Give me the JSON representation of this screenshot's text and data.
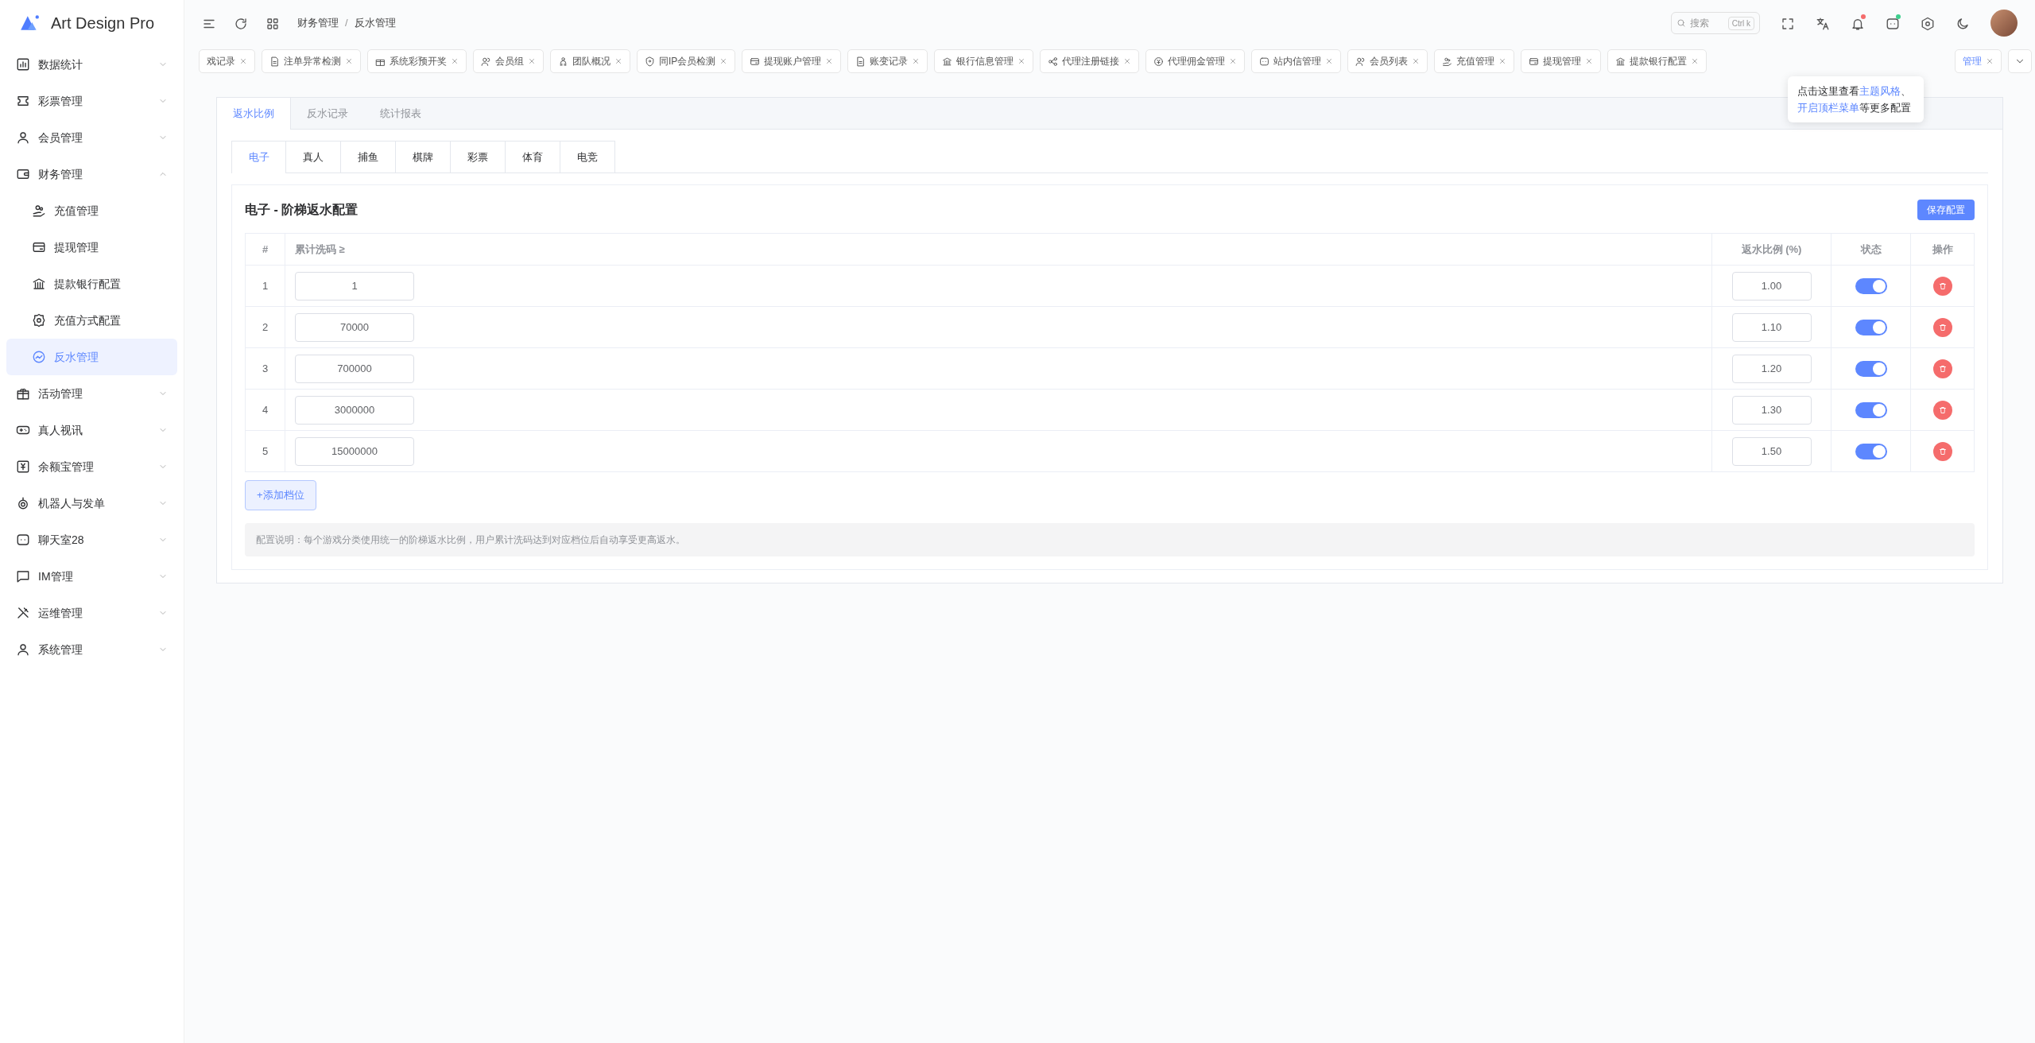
{
  "app": {
    "name": "Art Design Pro"
  },
  "sidebar": {
    "items": [
      {
        "label": "数据统计",
        "expanded": false
      },
      {
        "label": "彩票管理",
        "expanded": false
      },
      {
        "label": "会员管理",
        "expanded": false
      },
      {
        "label": "财务管理",
        "expanded": true,
        "children": [
          {
            "label": "充值管理",
            "selected": false
          },
          {
            "label": "提现管理",
            "selected": false
          },
          {
            "label": "提款银行配置",
            "selected": false
          },
          {
            "label": "充值方式配置",
            "selected": false
          },
          {
            "label": "反水管理",
            "selected": true
          }
        ]
      },
      {
        "label": "活动管理",
        "expanded": false
      },
      {
        "label": "真人视讯",
        "expanded": false
      },
      {
        "label": "余额宝管理",
        "expanded": false
      },
      {
        "label": "机器人与发单",
        "expanded": false
      },
      {
        "label": "聊天室28",
        "expanded": false
      },
      {
        "label": "IM管理",
        "expanded": false
      },
      {
        "label": "运维管理",
        "expanded": false
      },
      {
        "label": "系统管理",
        "expanded": false
      }
    ]
  },
  "breadcrumb": [
    "财务管理",
    "反水管理"
  ],
  "breadcrumb_separator": "/",
  "search": {
    "placeholder": "搜索",
    "shortcut": "Ctrl k"
  },
  "notifications": {
    "bell_unread": true,
    "chat_unread": true
  },
  "open_tabs": [
    {
      "label": "戏记录",
      "selected": false
    },
    {
      "label": "注单异常检测",
      "selected": false
    },
    {
      "label": "系统彩预开奖",
      "selected": false
    },
    {
      "label": "会员组",
      "selected": false
    },
    {
      "label": "团队概况",
      "selected": false
    },
    {
      "label": "同IP会员检测",
      "selected": false
    },
    {
      "label": "提现账户管理",
      "selected": false
    },
    {
      "label": "账变记录",
      "selected": false
    },
    {
      "label": "银行信息管理",
      "selected": false
    },
    {
      "label": "代理注册链接",
      "selected": false
    },
    {
      "label": "代理佣金管理",
      "selected": false
    },
    {
      "label": "站内信管理",
      "selected": false
    },
    {
      "label": "会员列表",
      "selected": false
    },
    {
      "label": "充值管理",
      "selected": false
    },
    {
      "label": "提现管理",
      "selected": false
    },
    {
      "label": "提款银行配置",
      "selected": false
    },
    {
      "label": "管理",
      "selected": true
    }
  ],
  "tooltip": {
    "text": "点击这里查看**主题风格**、**开启顶栏菜单**等更多配置"
  },
  "page_tabs": [
    {
      "label": "返水比例",
      "selected": true
    },
    {
      "label": "反水记录",
      "selected": false
    },
    {
      "label": "统计报表",
      "selected": false
    }
  ],
  "category_tabs": [
    {
      "label": "电子",
      "selected": true
    },
    {
      "label": "真人",
      "selected": false
    },
    {
      "label": "捕鱼",
      "selected": false
    },
    {
      "label": "棋牌",
      "selected": false
    },
    {
      "label": "彩票",
      "selected": false
    },
    {
      "label": "体育",
      "selected": false
    },
    {
      "label": "电竞",
      "selected": false
    }
  ],
  "panel": {
    "title": "电子 - 阶梯返水配置",
    "save_button": "保存配置",
    "add_button": "+添加档位",
    "note": "配置说明：每个游戏分类使用统一的阶梯返水比例，用户累计洗码达到对应档位后自动享受更高返水。"
  },
  "table": {
    "columns": [
      "#",
      "累计洗码 ≥",
      "返水比例 (%)",
      "状态",
      "操作"
    ],
    "rows": [
      {
        "index": "1",
        "threshold": "1",
        "ratio": "1.00",
        "enabled": true
      },
      {
        "index": "2",
        "threshold": "70000",
        "ratio": "1.10",
        "enabled": true
      },
      {
        "index": "3",
        "threshold": "700000",
        "ratio": "1.20",
        "enabled": true
      },
      {
        "index": "4",
        "threshold": "3000000",
        "ratio": "1.30",
        "enabled": true
      },
      {
        "index": "5",
        "threshold": "15000000",
        "ratio": "1.50",
        "enabled": true
      }
    ]
  }
}
